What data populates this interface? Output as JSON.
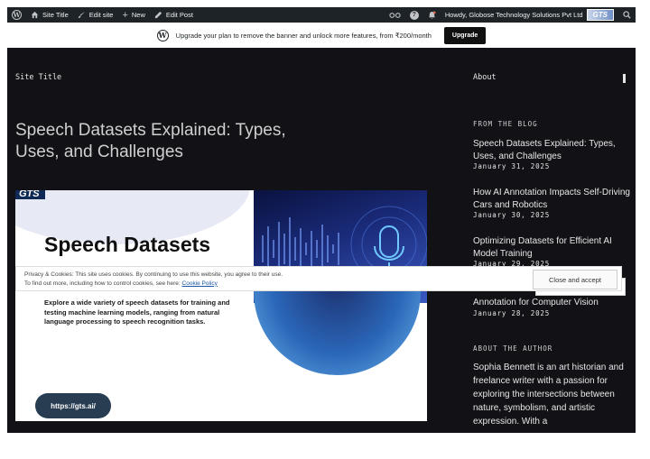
{
  "admin_bar": {
    "site_title": "Site Title",
    "edit_site": "Edit site",
    "new": "New",
    "edit_post": "Edit Post",
    "howdy": "Howdy, Globose Technology Solutions Pvt Ltd",
    "avatar_text": "GTS",
    "icons": [
      "wordpress-icon",
      "home-icon",
      "brush-icon",
      "plus-icon",
      "pencil-icon",
      "reader-icon",
      "help-icon",
      "notifications-icon",
      "search-icon"
    ]
  },
  "banner": {
    "text": "Upgrade your plan to remove the banner and unlock more features, from ₹200/month",
    "button": "Upgrade"
  },
  "header": {
    "site_title": "Site Title",
    "nav_about": "About"
  },
  "post": {
    "title": "Speech Datasets Explained: Types, Uses, and Challenges"
  },
  "featured": {
    "logo": "GTS",
    "heading": "Speech Datasets",
    "description": "Explore a wide variety of speech datasets for training and testing machine learning models, ranging from natural language processing to speech recognition tasks.",
    "url": "https://gts.ai/"
  },
  "sidebar": {
    "from_blog": "FROM THE BLOG",
    "posts": [
      {
        "title": "Speech Datasets Explained: Types, Uses, and Challenges",
        "date": "January 31, 2025"
      },
      {
        "title": "How AI Annotation Impacts Self-Driving Cars and Robotics",
        "date": "January 30, 2025"
      },
      {
        "title": "Optimizing Datasets for Efficient AI Model Training",
        "date": "January 29, 2025"
      },
      {
        "title": "Annotation for Computer Vision",
        "date": "January 28, 2025"
      }
    ],
    "about_author": "ABOUT THE AUTHOR",
    "bio": "Sophia Bennett is an art historian and freelance writer with a passion for exploring the intersections between nature, symbolism, and artistic expression. With a"
  },
  "cookie": {
    "line1": "Privacy & Cookies: This site uses cookies. By continuing to use this website, you agree to their use.",
    "line2_prefix": "To find out more, including how to control cookies, see here: ",
    "link": "Cookie Policy",
    "button": "Close and accept"
  },
  "colors": {
    "admin_bar": "#1d2327",
    "site_bg": "#121216",
    "pill": "#283c52"
  }
}
